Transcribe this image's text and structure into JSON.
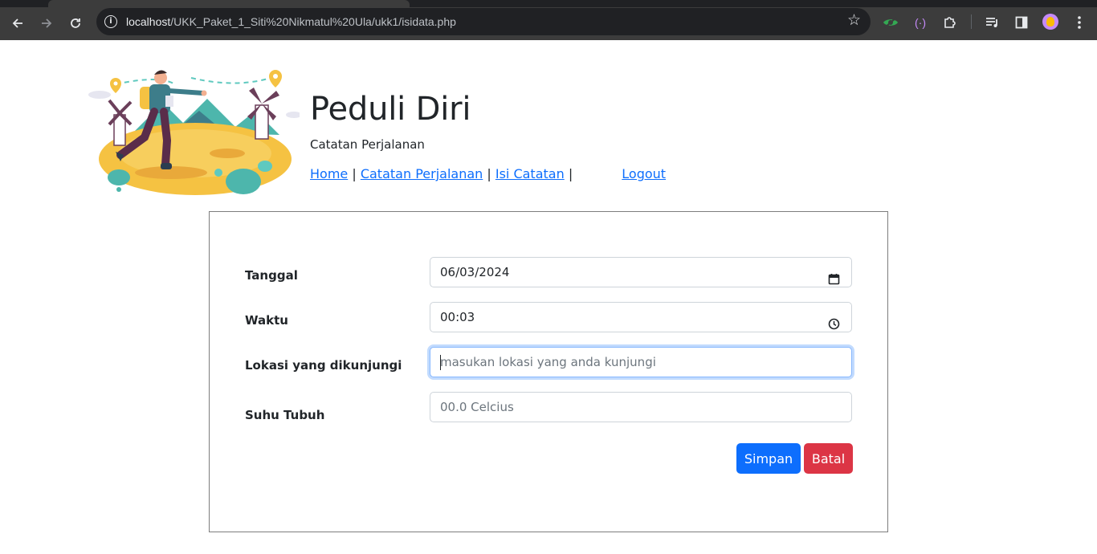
{
  "browser": {
    "url_host": "localhost",
    "url_path": "/UKK_Paket_1_Siti%20Nikmatul%20Ula/ukk1/isidata.php",
    "icons": {
      "back": "back-arrow-icon",
      "forward": "forward-arrow-icon",
      "reload": "reload-icon",
      "info": "info-icon",
      "bookmark": "star-icon",
      "extensions": [
        "eye-extension-icon",
        "bracket-extension-icon",
        "puzzle-icon",
        "media-queue-icon",
        "sidebar-icon",
        "profile-avatar-icon",
        "menu-icon"
      ]
    }
  },
  "header": {
    "title": "Peduli Diri",
    "subtitle": "Catatan Perjalanan",
    "nav": {
      "home": "Home",
      "sep1": "|",
      "catatan": "Catatan Perjalanan",
      "sep2": "|",
      "isi": "Isi Catatan",
      "sep3": "|",
      "logout": "Logout"
    }
  },
  "form": {
    "tanggal": {
      "label": "Tanggal",
      "value": "06/03/2024",
      "icon": "calendar-icon"
    },
    "waktu": {
      "label": "Waktu",
      "value": "00:03",
      "icon": "clock-icon"
    },
    "lokasi": {
      "label": "Lokasi yang dikunjungi",
      "placeholder": "masukan lokasi yang anda kunjungi"
    },
    "suhu": {
      "label": "Suhu Tubuh",
      "placeholder": "00.0 Celcius"
    },
    "save_label": "Simpan",
    "cancel_label": "Batal"
  },
  "colors": {
    "primary": "#0d6efd",
    "danger": "#dc3545",
    "link": "#0d6efd",
    "chrome": "#3c3c3c"
  }
}
